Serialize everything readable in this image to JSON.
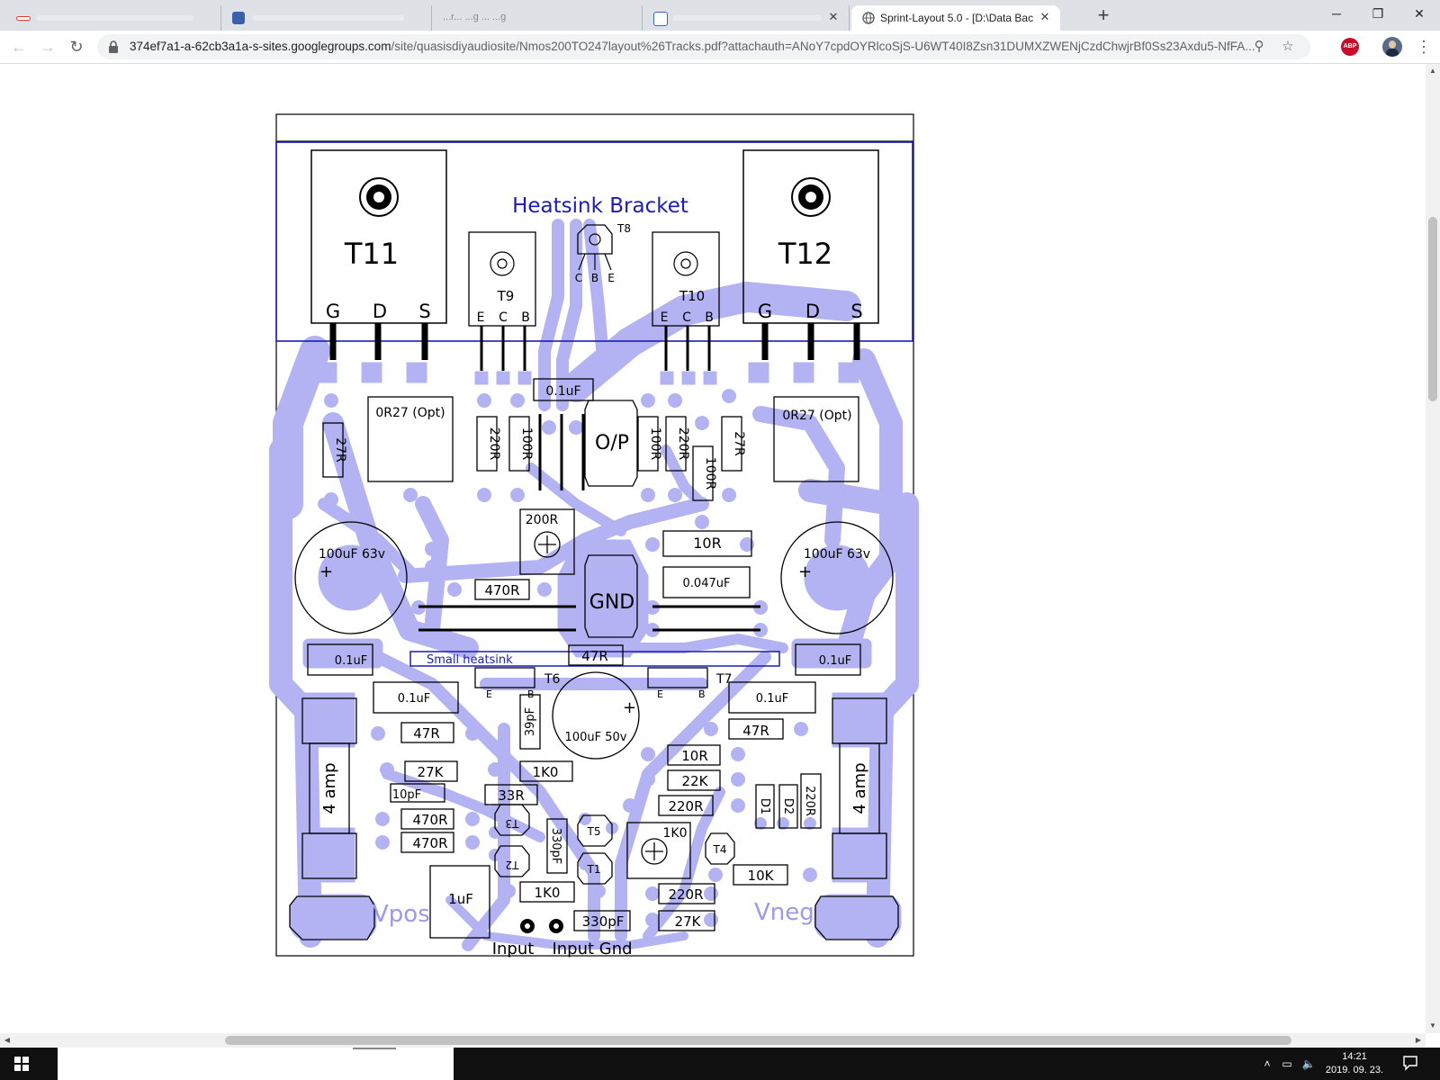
{
  "browser": {
    "tabs": [
      {
        "title": "",
        "active": false
      },
      {
        "title": "",
        "active": false
      },
      {
        "title": "...r... ...g ... ...g",
        "active": false
      },
      {
        "title": "",
        "active": false
      },
      {
        "title": "Sprint-Layout 5.0 - [D:\\Data Back",
        "active": true
      }
    ],
    "url_host": "374ef7a1-a-62cb3a1a-s-sites.googlegroups.com",
    "url_path": "/site/quasisdiyaudiosite/Nmos200TO247layout%26Tracks.pdf?attachauth=ANoY7cpdOYRlcoSjS-U6WT40I8Zsn31DUMXZWENjCzdChwjrBf0Ss23Axdu5-NfFA...",
    "extension_label": "ABP",
    "colors": {
      "tabstrip": "#dee1e6",
      "accent_ext": "#c70d2c"
    }
  },
  "pcb": {
    "bracket_label": "Heatsink Bracket",
    "small_heatsink_label": "Small heatsink",
    "big_transistors": [
      {
        "name": "T11",
        "pins": [
          "G",
          "D",
          "S"
        ]
      },
      {
        "name": "T12",
        "pins": [
          "G",
          "D",
          "S"
        ]
      }
    ],
    "mid_transistors": [
      {
        "name": "T9",
        "pins": [
          "E",
          "C",
          "B"
        ]
      },
      {
        "name": "T10",
        "pins": [
          "E",
          "C",
          "B"
        ]
      }
    ],
    "t8": {
      "name": "T8",
      "pins": [
        "C",
        "B",
        "E"
      ]
    },
    "connector_labels": {
      "vpos": "Vpos",
      "vneg": "Vneg",
      "input": "Input",
      "input_gnd": "Input Gnd"
    },
    "pads_text": {
      "op": "O/P",
      "gnd": "GND"
    },
    "caps_big": [
      "100uF 63v",
      "100uF 63v",
      "100uF 50v"
    ],
    "fuses": [
      "4 amp",
      "4 amp"
    ],
    "t6": "T6",
    "t7": "T7",
    "small_transistors": [
      "T3",
      "T2",
      "T5",
      "T1",
      "T4"
    ],
    "diodes": [
      "D1",
      "D2"
    ],
    "pin_letters": {
      "e": "E",
      "b": "B",
      "c": "C"
    },
    "components": [
      "0.1uF",
      "0R27 (Opt)",
      "0R27 (Opt)",
      "27R",
      "220R",
      "100R",
      "100R",
      "220R",
      "100R",
      "27R",
      "200R",
      "10R",
      "470R",
      "0.047uF",
      "47R",
      "0.1uF",
      "0.1uF",
      "0.1uF",
      "0.1uF",
      "39pF",
      "47R",
      "47R",
      "27K",
      "1K0",
      "10R",
      "22K",
      "10pF",
      "33R",
      "220R",
      "470R",
      "470R",
      "330pF",
      "1K0",
      "220R",
      "10K",
      "1uF",
      "1K0",
      "220R",
      "330pF",
      "27K"
    ],
    "colors": {
      "track": "#b3b3f3",
      "silk": "#000000",
      "label_blue": "#1c1cb4",
      "connector_text": "#9a9ae8"
    }
  },
  "taskbar": {
    "time": "14:21",
    "date": "2019. 09. 23."
  }
}
